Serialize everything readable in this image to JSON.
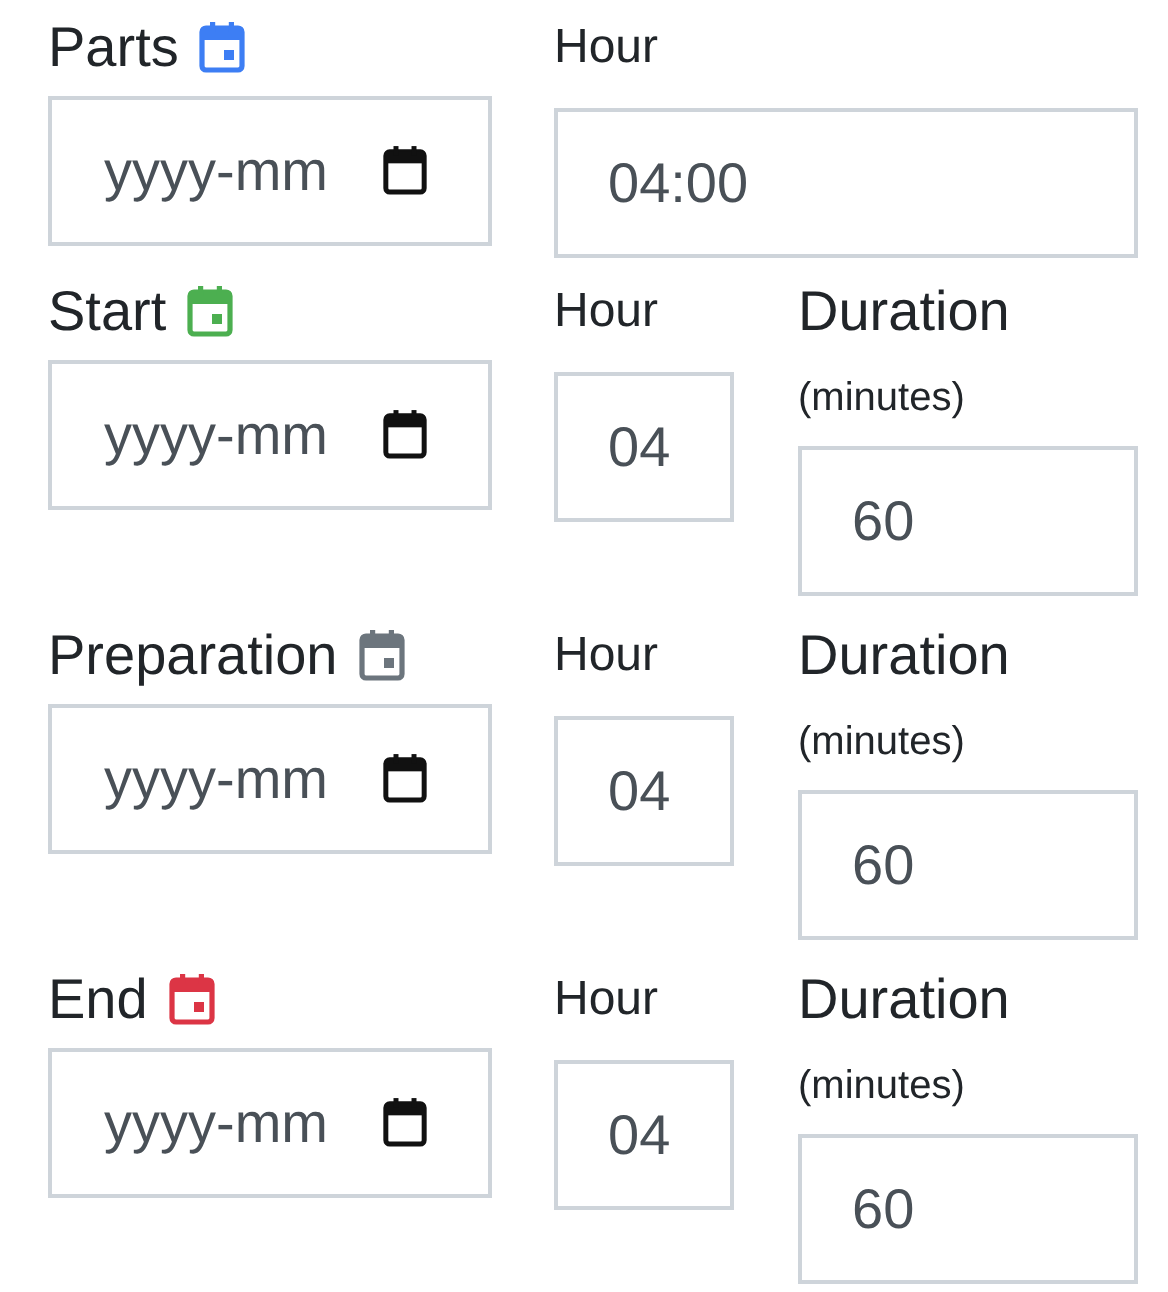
{
  "groups": [
    {
      "label": "Parts",
      "color": "#3d7ef4",
      "date": {
        "placeholder": "yyyy-mm"
      },
      "hour": {
        "label": "Hour",
        "value": "04:00"
      }
    },
    {
      "label": "Start",
      "color": "#4caf50",
      "date": {
        "placeholder": "yyyy-mm"
      },
      "hour": {
        "label": "Hour",
        "value": "04"
      },
      "duration": {
        "label": "Duration",
        "unit": "(minutes)",
        "value": "60"
      }
    },
    {
      "label": "Preparation",
      "color": "#6c757d",
      "date": {
        "placeholder": "yyyy-mm"
      },
      "hour": {
        "label": "Hour",
        "value": "04"
      },
      "duration": {
        "label": "Duration",
        "unit": "(minutes)",
        "value": "60"
      }
    },
    {
      "label": "End",
      "color": "#dc3545",
      "date": {
        "placeholder": "yyyy-mm"
      },
      "hour": {
        "label": "Hour",
        "value": "04"
      },
      "duration": {
        "label": "Duration",
        "unit": "(minutes)",
        "value": "60"
      }
    }
  ]
}
